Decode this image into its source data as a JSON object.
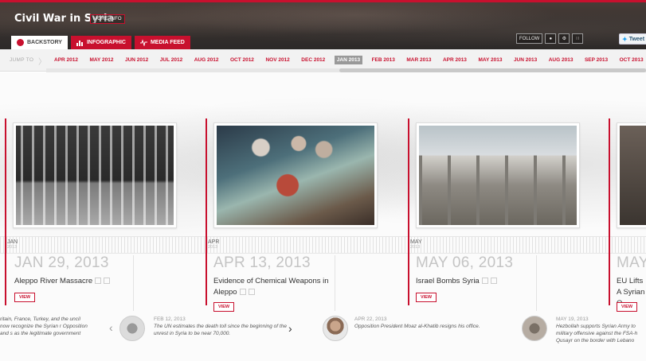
{
  "header": {
    "title": "Civil War in Syria",
    "more_info": "MORE INFO",
    "tabs": [
      {
        "label": "BACKSTORY",
        "icon": "life-ring-icon"
      },
      {
        "label": "INFOGRAPHIC",
        "icon": "bar-chart-icon"
      },
      {
        "label": "MEDIA FEED",
        "icon": "pulse-icon"
      }
    ],
    "follow_label": "FOLLOW",
    "tweet_label": "Tweet"
  },
  "nav": {
    "jump_label": "JUMP TO",
    "months": [
      "APR 2012",
      "MAY 2012",
      "JUN 2012",
      "JUL 2012",
      "AUG 2012",
      "OCT 2012",
      "NOV 2012",
      "DEC 2012",
      "JAN 2013",
      "FEB 2013",
      "MAR 2013",
      "APR 2013",
      "MAY 2013",
      "JUN 2013",
      "AUG 2013",
      "SEP 2013",
      "OCT 2013"
    ],
    "active_month": "JAN 2013"
  },
  "timeline": {
    "columns": [
      {
        "month": "JAN",
        "year": "2013",
        "date": "JAN 29, 2013",
        "title": "Aleppo River Massacre",
        "view": "VIEW"
      },
      {
        "month": "APR",
        "year": "2013",
        "date": "APR 13, 2013",
        "title": "Evidence of Chemical Weapons in Aleppo",
        "view": "VIEW"
      },
      {
        "month": "MAY",
        "year": "2013",
        "date": "MAY 06, 2013",
        "title": "Israel Bombs Syria",
        "view": "VIEW"
      },
      {
        "month": "",
        "year": "",
        "date": "MAY",
        "title": "EU Lifts A Syrian O",
        "view": "VIEW"
      }
    ],
    "lower_events": [
      {
        "date": "",
        "text": "ritain, France, Turkey, and the uncil now recognize the Syrian r Opposition and s as the legitimate government"
      },
      {
        "date": "FEB 12, 2013",
        "text": "The UN estimates the death toll since the beginning of the unrest in Syria to be near 70,000."
      },
      {
        "date": "APR 22, 2013",
        "text": "Opposition President Moaz al-Khatib resigns his office."
      },
      {
        "date": "MAY 19, 2013",
        "text": "Hezbollah supports Syrian Army to military offensive against the FSA-h Qusayr on the border with Lebano"
      }
    ]
  },
  "colors": {
    "accent": "#c8102e",
    "muted": "#c4c4c4"
  }
}
